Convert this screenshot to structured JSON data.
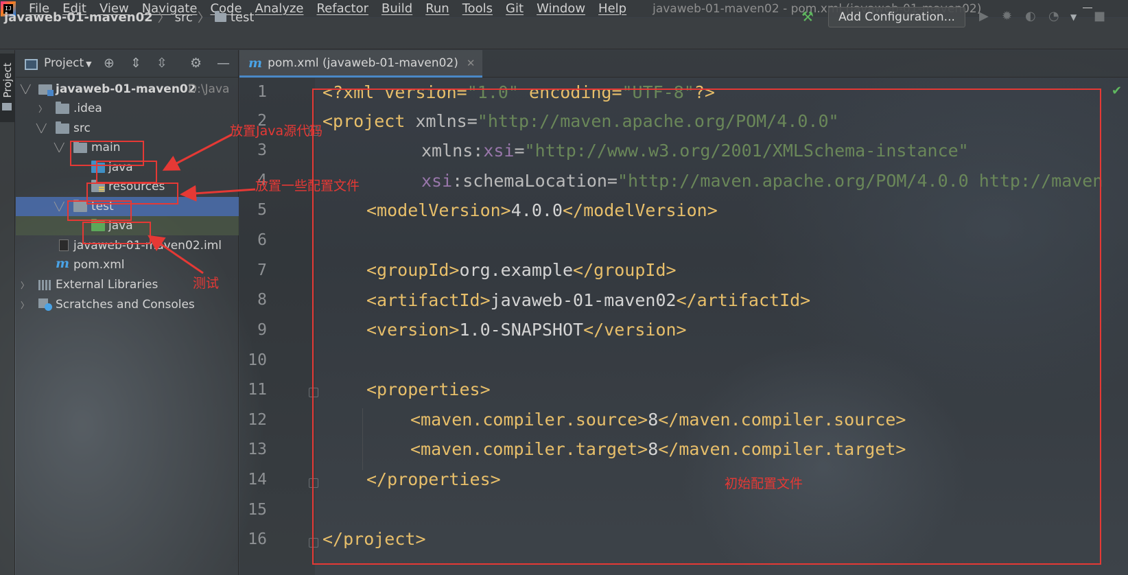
{
  "menubar": {
    "items": [
      "File",
      "Edit",
      "View",
      "Navigate",
      "Code",
      "Analyze",
      "Refactor",
      "Build",
      "Run",
      "Tools",
      "Git",
      "Window",
      "Help"
    ],
    "window_title": "javaweb-01-maven02 - pom.xml (javaweb-01-maven02)"
  },
  "navbar": {
    "breadcrumb": [
      "javaweb-01-maven02",
      "src",
      "test"
    ],
    "add_configuration": "Add Configuration..."
  },
  "sidebar": {
    "stripe_label": "Project",
    "view_selector": "Project",
    "tree": [
      {
        "label": "javaweb-01-maven02",
        "path": "D:\\Java"
      },
      {
        "label": ".idea"
      },
      {
        "label": "src"
      },
      {
        "label": "main"
      },
      {
        "label": "java"
      },
      {
        "label": "resources"
      },
      {
        "label": "test"
      },
      {
        "label": "java"
      },
      {
        "label": "javaweb-01-maven02.iml"
      },
      {
        "label": "pom.xml"
      },
      {
        "label": "External Libraries"
      },
      {
        "label": "Scratches and Consoles"
      }
    ]
  },
  "editor": {
    "tab_label": "pom.xml (javaweb-01-maven02)",
    "line_numbers": [
      "1",
      "2",
      "3",
      "4",
      "5",
      "6",
      "7",
      "8",
      "9",
      "10",
      "11",
      "12",
      "13",
      "14",
      "15",
      "16"
    ],
    "code": {
      "l1_a": "<?xml version=",
      "l1_b": "\"1.0\"",
      "l1_c": " encoding=",
      "l1_d": "\"UTF-8\"",
      "l1_e": "?>",
      "l2_a": "<project ",
      "l2_b": "xmlns=",
      "l2_c": "\"http://maven.apache.org/POM/4.0.0\"",
      "l3_a": "xmlns:",
      "l3_b": "xsi",
      "l3_c": "=",
      "l3_d": "\"http://www.w3.org/2001/XMLSchema-instance\"",
      "l4_a": "xsi",
      "l4_b": ":schemaLocation=",
      "l4_c": "\"http://maven.apache.org/POM/4.0.0 http://maven",
      "l5_a": "<modelVersion>",
      "l5_b": "4.0.0",
      "l5_c": "</modelVersion>",
      "l7_a": "<groupId>",
      "l7_b": "org.example",
      "l7_c": "</groupId>",
      "l8_a": "<artifactId>",
      "l8_b": "javaweb-01-maven02",
      "l8_c": "</artifactId>",
      "l9_a": "<version>",
      "l9_b": "1.0-SNAPSHOT",
      "l9_c": "</version>",
      "l11": "<properties>",
      "l12_a": "<maven.compiler.source>",
      "l12_b": "8",
      "l12_c": "</maven.compiler.source>",
      "l13_a": "<maven.compiler.target>",
      "l13_b": "8",
      "l13_c": "</maven.compiler.target>",
      "l14": "</properties>",
      "l16": "</project>"
    }
  },
  "annotations": {
    "main_java": "放置Java源代码",
    "resources": "放置一些配置文件",
    "test": "测试",
    "pom": "初始配置文件"
  },
  "colors": {
    "annotation": "#e53935",
    "xml_tag": "#e8bf6a",
    "xml_string": "#6a8759",
    "xml_namespace": "#9876aa",
    "selection": "#4b6eaf"
  }
}
